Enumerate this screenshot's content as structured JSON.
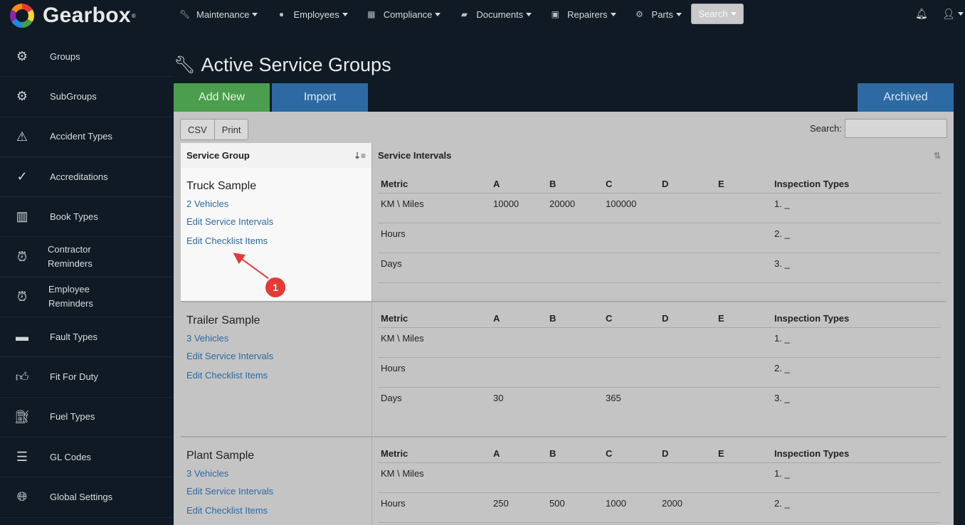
{
  "app": {
    "name": "Gearbox",
    "reg": "®"
  },
  "topnav": {
    "items": [
      {
        "label": "Maintenance",
        "icon": "wrench-icon"
      },
      {
        "label": "Employees",
        "icon": "user-circle-icon"
      },
      {
        "label": "Compliance",
        "icon": "calendar-check-icon"
      },
      {
        "label": "Documents",
        "icon": "folder-open-icon"
      },
      {
        "label": "Repairers",
        "icon": "address-book-icon"
      },
      {
        "label": "Parts",
        "icon": "gear-icon"
      }
    ],
    "search_label": "Search"
  },
  "sidebar": {
    "items": [
      {
        "label": "Groups",
        "icon": "gears-icon"
      },
      {
        "label": "SubGroups",
        "icon": "gears-icon"
      },
      {
        "label": "Accident Types",
        "icon": "warning-icon"
      },
      {
        "label": "Accreditations",
        "icon": "checkmark-icon"
      },
      {
        "label": "Book Types",
        "icon": "books-icon"
      },
      {
        "label": "Contractor\nReminders",
        "icon": "alarm-clock-icon"
      },
      {
        "label": "Employee\nReminders",
        "icon": "alarm-clock-icon"
      },
      {
        "label": "Fault Types",
        "icon": "car-battery-icon"
      },
      {
        "label": "Fit For Duty",
        "icon": "thumbs-up-icon"
      },
      {
        "label": "Fuel Types",
        "icon": "gas-pump-icon"
      },
      {
        "label": "GL Codes",
        "icon": "list-alt-icon"
      },
      {
        "label": "Global Settings",
        "icon": "globe-icon"
      }
    ]
  },
  "page": {
    "title": "Active Service Groups"
  },
  "actions": {
    "add_new": "Add New",
    "import": "Import",
    "archived": "Archived"
  },
  "export": {
    "csv": "CSV",
    "print": "Print"
  },
  "search": {
    "label": "Search:",
    "value": ""
  },
  "table": {
    "col_group": "Service Group",
    "col_intervals": "Service Intervals",
    "inner_headers": {
      "metric": "Metric",
      "a": "A",
      "b": "B",
      "c": "C",
      "d": "D",
      "e": "E",
      "inspection": "Inspection Types"
    },
    "groups": [
      {
        "name": "Truck Sample",
        "vehicles": "2 Vehicles",
        "edit_intervals": "Edit Service Intervals",
        "edit_checklist": "Edit Checklist Items",
        "rows": [
          {
            "metric": "KM \\ Miles",
            "a": "10000",
            "b": "20000",
            "c": "100000",
            "d": "",
            "e": "",
            "inspection": "1. _"
          },
          {
            "metric": "Hours",
            "a": "",
            "b": "",
            "c": "",
            "d": "",
            "e": "",
            "inspection": "2. _"
          },
          {
            "metric": "Days",
            "a": "",
            "b": "",
            "c": "",
            "d": "",
            "e": "",
            "inspection": "3. _"
          }
        ]
      },
      {
        "name": "Trailer Sample",
        "vehicles": "3 Vehicles",
        "edit_intervals": "Edit Service Intervals",
        "edit_checklist": "Edit Checklist Items",
        "rows": [
          {
            "metric": "KM \\ Miles",
            "a": "",
            "b": "",
            "c": "",
            "d": "",
            "e": "",
            "inspection": "1. _"
          },
          {
            "metric": "Hours",
            "a": "",
            "b": "",
            "c": "",
            "d": "",
            "e": "",
            "inspection": "2. _"
          },
          {
            "metric": "Days",
            "a": "30",
            "b": "",
            "c": "365",
            "d": "",
            "e": "",
            "inspection": "3. _"
          }
        ]
      },
      {
        "name": "Plant Sample",
        "vehicles": "3 Vehicles",
        "edit_intervals": "Edit Service Intervals",
        "edit_checklist": "Edit Checklist Items",
        "rows": [
          {
            "metric": "KM \\ Miles",
            "a": "",
            "b": "",
            "c": "",
            "d": "",
            "e": "",
            "inspection": "1. _"
          },
          {
            "metric": "Hours",
            "a": "250",
            "b": "500",
            "c": "1000",
            "d": "2000",
            "e": "",
            "inspection": "2. _"
          }
        ]
      }
    ]
  },
  "annotation": {
    "step": "1"
  },
  "colors": {
    "add_new": "#4b9e4d",
    "primary": "#2d6aa3",
    "link": "#2d6aa3",
    "annotation": "#e53935"
  }
}
